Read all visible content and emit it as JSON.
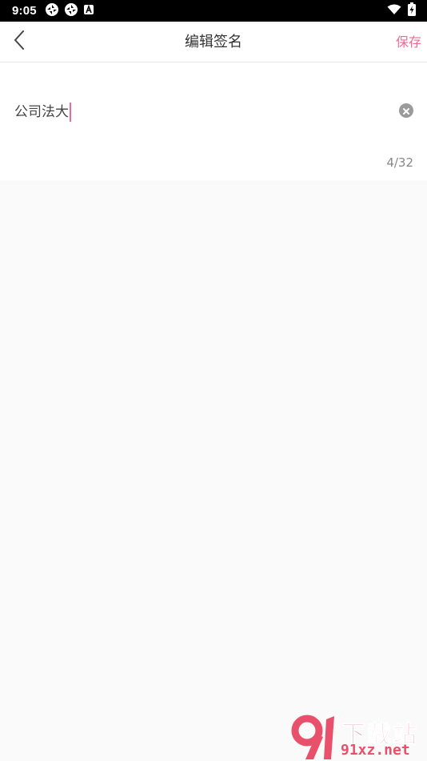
{
  "status_bar": {
    "time": "9:05",
    "left_icons": [
      "aperture-icon",
      "aperture-icon",
      "a-notification-icon"
    ],
    "right_icons": [
      "wifi-icon",
      "battery-charging-icon"
    ]
  },
  "header": {
    "title": "编辑签名",
    "save_label": "保存",
    "back_icon": "chevron-left-icon"
  },
  "editor": {
    "value": "公司法大",
    "clear_icon": "clear-circle-icon",
    "counter": "4/32"
  },
  "watermark": {
    "line1": "下载站",
    "line2": "91xz.net"
  },
  "colors": {
    "accent": "#f06a94",
    "background": "#fafafa",
    "panel": "#ffffff",
    "status_bar": "#000000",
    "watermark": "#e9506b"
  }
}
